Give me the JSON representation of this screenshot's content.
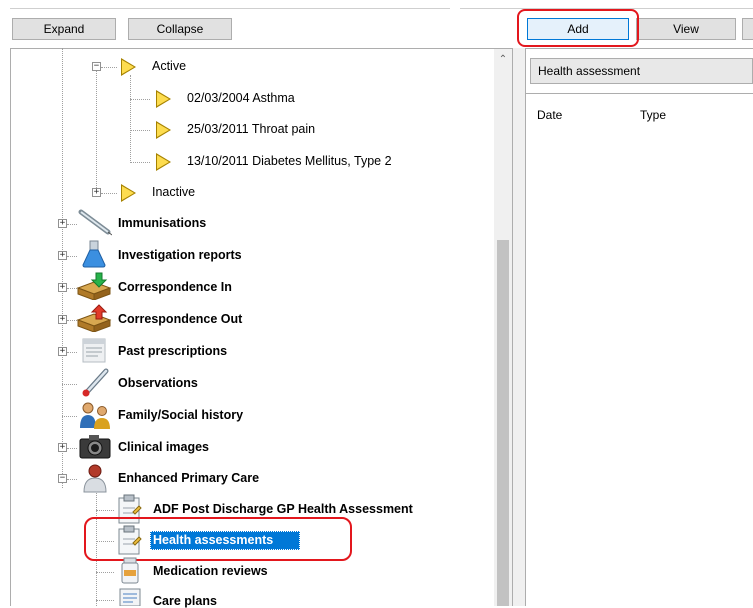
{
  "toolbar_left": {
    "expand_label": "Expand",
    "collapse_label": "Collapse"
  },
  "toolbar_right": {
    "add_label": "Add",
    "view_label": "View"
  },
  "tree": {
    "active_label": "Active",
    "active_items": [
      {
        "label": "02/03/2004  Asthma"
      },
      {
        "label": "25/03/2011  Throat pain"
      },
      {
        "label": "13/10/2011  Diabetes Mellitus, Type 2"
      }
    ],
    "inactive_label": "Inactive",
    "sections": [
      {
        "label": "Immunisations"
      },
      {
        "label": "Investigation reports"
      },
      {
        "label": "Correspondence In"
      },
      {
        "label": "Correspondence Out"
      },
      {
        "label": "Past prescriptions"
      },
      {
        "label": "Observations"
      },
      {
        "label": "Family/Social history"
      },
      {
        "label": "Clinical images"
      },
      {
        "label": "Enhanced Primary Care"
      }
    ],
    "epc_children": [
      {
        "label": "ADF Post Discharge GP Health Assessment"
      },
      {
        "label": "Health assessments"
      },
      {
        "label": "Medication reviews"
      },
      {
        "label": "Care plans"
      }
    ]
  },
  "right_panel": {
    "dropdown_value": "Health assessment",
    "columns": [
      "Date",
      "Type"
    ]
  },
  "colors": {
    "selection": "#0078d7",
    "highlight_outline": "#e3171d",
    "folder_yellow": "#fddc4f"
  }
}
